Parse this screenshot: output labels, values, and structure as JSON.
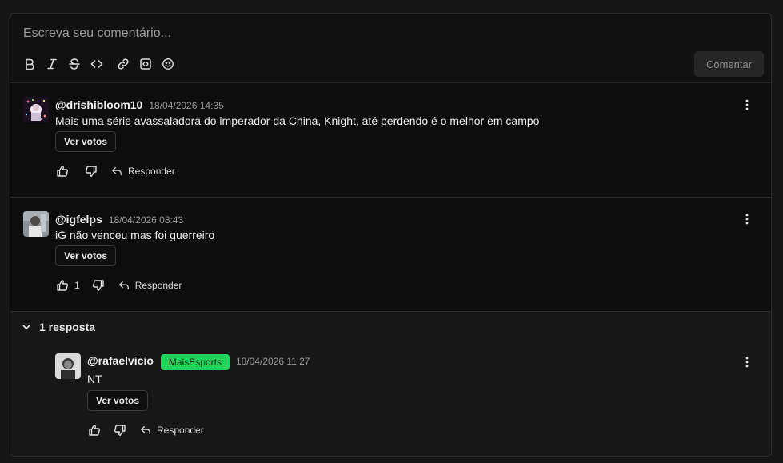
{
  "composer": {
    "placeholder": "Escreva seu comentário...",
    "submit_label": "Comentar",
    "tools": [
      "bold-icon",
      "italic-icon",
      "strikethrough-icon",
      "code-icon",
      "link-icon",
      "code-block-icon",
      "emoji-icon"
    ]
  },
  "comments": [
    {
      "user": "@drishibloom10",
      "date": "18/04/2026 14:35",
      "text": "Mais uma série avassaladora do imperador da China, Knight, até perdendo é o melhor em campo",
      "votes_label": "Ver votos",
      "likes": "",
      "reply_label": "Responder"
    },
    {
      "user": "@igfelps",
      "date": "18/04/2026 08:43",
      "text": "iG não venceu mas foi guerreiro",
      "votes_label": "Ver votos",
      "likes": "1",
      "reply_label": "Responder",
      "replies_toggle": "1 resposta",
      "replies": [
        {
          "user": "@rafaelvicio",
          "badge": "MaisEsports",
          "date": "18/04/2026 11:27",
          "text": "NT",
          "votes_label": "Ver votos",
          "reply_label": "Responder"
        }
      ]
    }
  ],
  "colors": {
    "badge": "#22d35a",
    "panel": "#111111",
    "border": "#2c2c2c"
  }
}
